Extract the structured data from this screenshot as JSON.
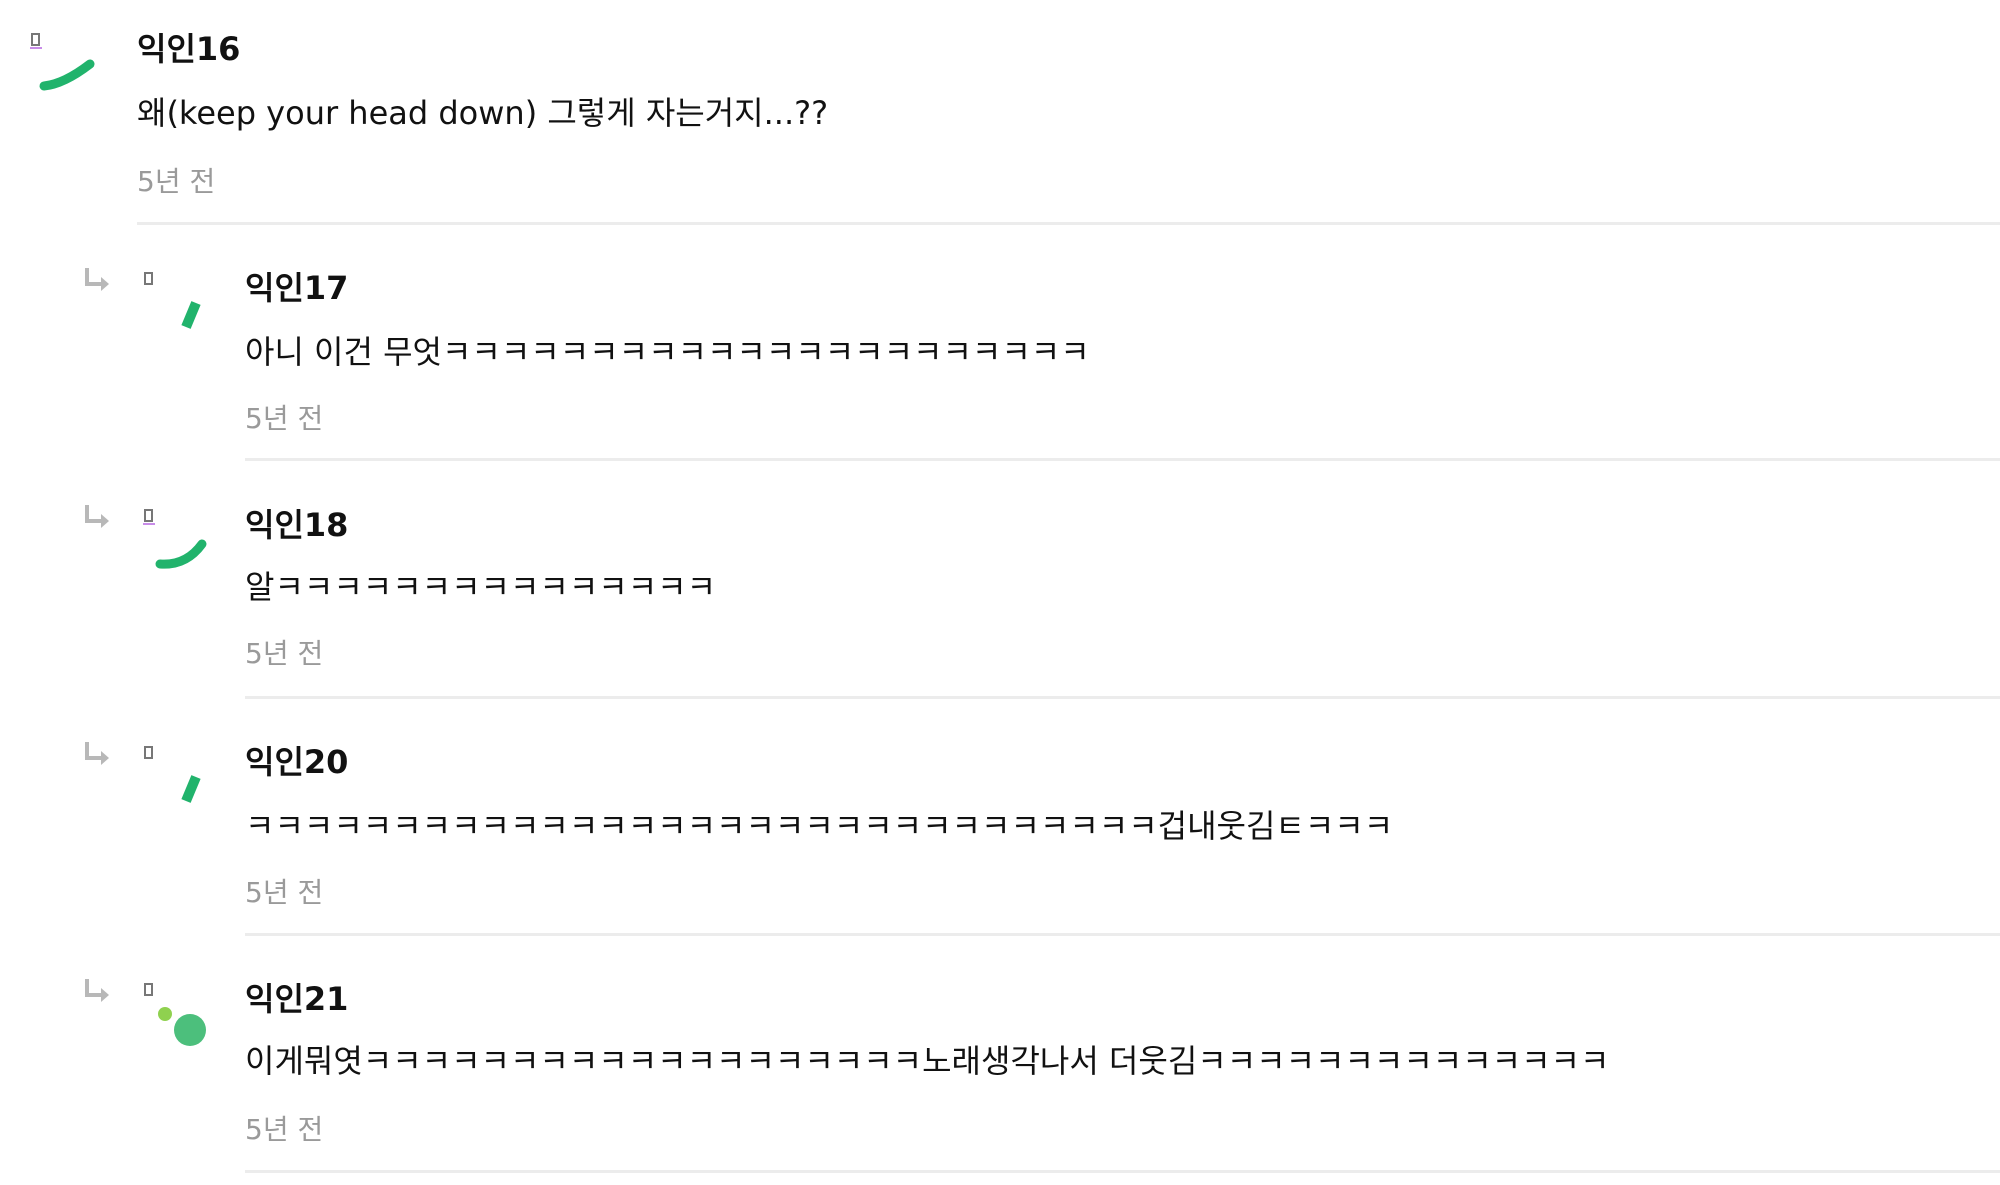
{
  "comments": [
    {
      "author": "익인16",
      "text": "왜(keep your head down) 그렇게 자는거지...??",
      "time": "5년 전"
    },
    {
      "author": "익인17",
      "text": "아니 이건 무엇ㅋㅋㅋㅋㅋㅋㅋㅋㅋㅋㅋㅋㅋㅋㅋㅋㅋㅋㅋㅋㅋㅋ",
      "time": "5년 전"
    },
    {
      "author": "익인18",
      "text": "알ㅋㅋㅋㅋㅋㅋㅋㅋㅋㅋㅋㅋㅋㅋㅋ",
      "time": "5년 전"
    },
    {
      "author": "익인20",
      "text": "ㅋㅋㅋㅋㅋㅋㅋㅋㅋㅋㅋㅋㅋㅋㅋㅋㅋㅋㅋㅋㅋㅋㅋㅋㅋㅋㅋㅋㅋㅋㅋ겁내웃김ㅌㅋㅋㅋ",
      "time": "5년 전"
    },
    {
      "author": "익인21",
      "text": "이게뭐엿ㅋㅋㅋㅋㅋㅋㅋㅋㅋㅋㅋㅋㅋㅋㅋㅋㅋㅋㅋ노래생각나서 더웃김ㅋㅋㅋㅋㅋㅋㅋㅋㅋㅋㅋㅋㅋㅋ",
      "time": "5년 전"
    }
  ],
  "colors": {
    "avatar_green": "#21b36c",
    "avatar_light_green": "#8fd14f",
    "divider": "#ececec",
    "muted_text": "#9a9a9a",
    "reply_arrow": "#b8b8b8"
  },
  "icons": {
    "reply": "reply-arrow-icon",
    "avatar": "avatar-icon"
  }
}
